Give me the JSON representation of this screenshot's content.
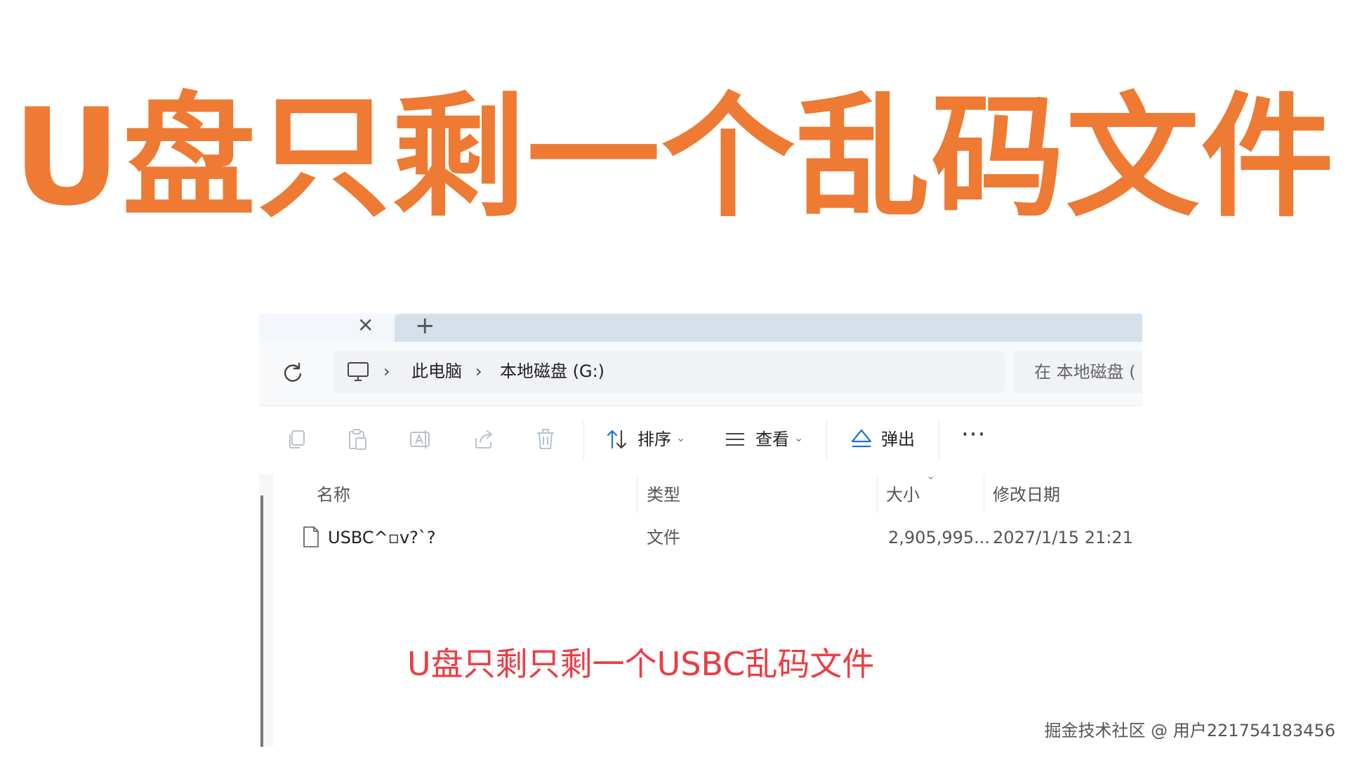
{
  "headline": "U盘只剩一个乱码文件",
  "tabs": {
    "close_symbol": "✕",
    "new_symbol": "+"
  },
  "address_bar": {
    "breadcrumbs": [
      {
        "label": "此电脑"
      },
      {
        "label": "本地磁盘 (G:)"
      }
    ],
    "chevron_symbol": "›",
    "search_placeholder": "在 本地磁盘 ("
  },
  "toolbar": {
    "sort_label": "排序",
    "view_label": "查看",
    "eject_label": "弹出",
    "more_symbol": "···",
    "caret_symbol": "⌄",
    "icons": [
      "copy-icon",
      "paste-icon",
      "rename-icon",
      "share-icon",
      "delete-icon",
      "sort-icon",
      "view-icon",
      "eject-icon",
      "more-icon"
    ]
  },
  "file_list": {
    "columns": [
      "名称",
      "类型",
      "大小",
      "修改日期"
    ],
    "sort_indicator": "⌄",
    "rows": [
      {
        "name": "USBC^▫v?`?",
        "type": "文件",
        "size": "2,905,995...",
        "modified": "2027/1/15 21:21"
      }
    ]
  },
  "overlay_caption": "U盘只剩只剩一个USBC乱码文件",
  "watermark": "掘金技术社区 @ 用户221754183456",
  "colors": {
    "headline": "#ee7a33",
    "caption": "#ee3b43",
    "eject_accent": "#1a73e8"
  }
}
